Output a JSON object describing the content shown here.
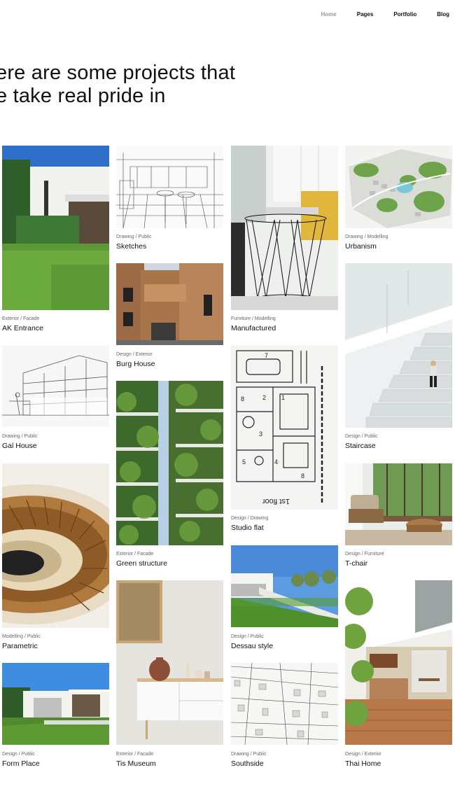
{
  "nav": {
    "items": [
      "Home",
      "Pages",
      "Portfolio",
      "Blog"
    ]
  },
  "hero": {
    "line1": "ere are some projects that",
    "line2": "e take real pride in"
  },
  "projects": [
    {
      "title": "AK Entrance",
      "category": "Exterior",
      "subcategory": "Facade"
    },
    {
      "title": "Sketches",
      "category": "Drawing",
      "subcategory": "Public"
    },
    {
      "title": "Manufactured",
      "category": "Furniture",
      "subcategory": "Modelling"
    },
    {
      "title": "Urbanism",
      "category": "Drawing",
      "subcategory": "Modelling"
    },
    {
      "title": "Burg House",
      "category": "Design",
      "subcategory": "Exterior"
    },
    {
      "title": "Gal House",
      "category": "Drawing",
      "subcategory": "Public"
    },
    {
      "title": "Studio flat",
      "category": "Design",
      "subcategory": "Drawing"
    },
    {
      "title": "Staircase",
      "category": "Design",
      "subcategory": "Public"
    },
    {
      "title": "Green structure",
      "category": "Exterior",
      "subcategory": "Facade"
    },
    {
      "title": "T-chair",
      "category": "Design",
      "subcategory": "Furniture"
    },
    {
      "title": "Parametric",
      "category": "Modelling",
      "subcategory": "Public"
    },
    {
      "title": "Dessau style",
      "category": "Design",
      "subcategory": "Public"
    },
    {
      "title": "Form Place",
      "category": "Design",
      "subcategory": "Public"
    },
    {
      "title": "Tis Museum",
      "category": "Exterior",
      "subcategory": "Facade"
    },
    {
      "title": "Southside",
      "category": "Drawing",
      "subcategory": "Public"
    },
    {
      "title": "Thai Home",
      "category": "Design",
      "subcategory": "Exterior"
    }
  ],
  "floor_plan_text": "1st floor"
}
